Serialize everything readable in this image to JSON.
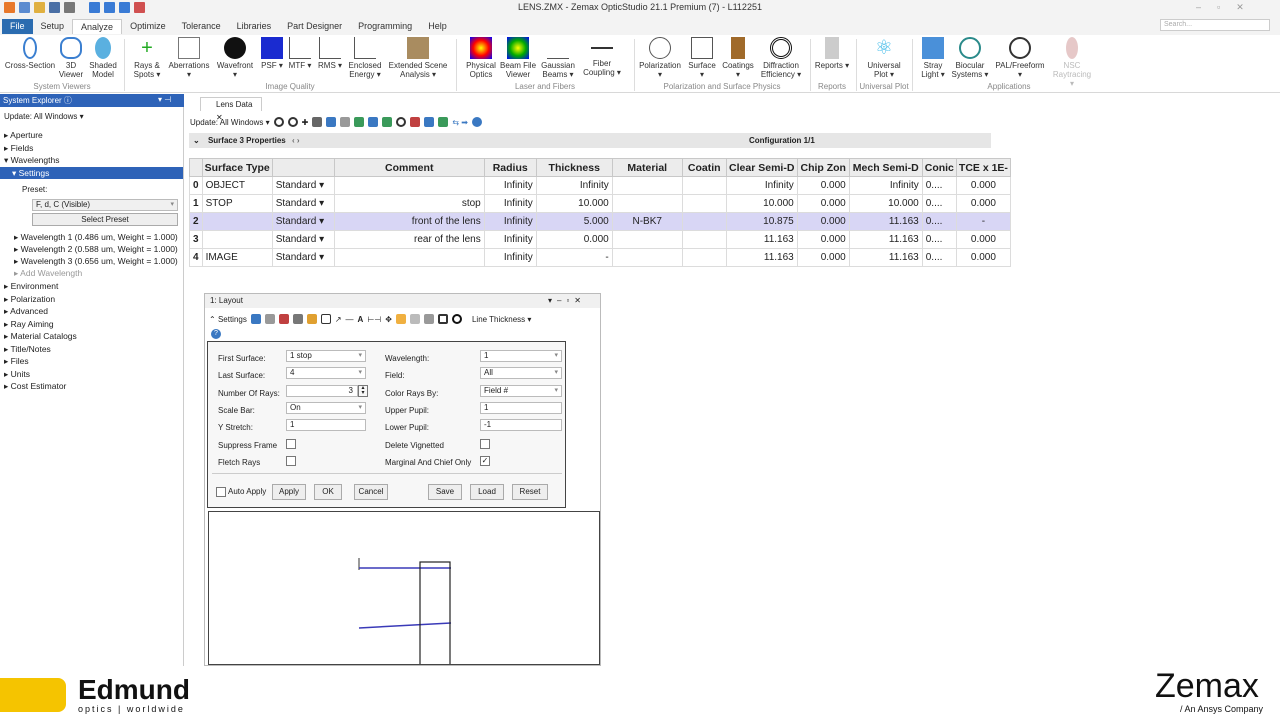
{
  "window": {
    "title": "LENS.ZMX - Zemax OpticStudio 21.1   Premium (7) - L112251",
    "search_placeholder": "Search..."
  },
  "menu_tabs": [
    "File",
    "Setup",
    "Analyze",
    "Optimize",
    "Tolerance",
    "Libraries",
    "Part Designer",
    "Programming",
    "Help"
  ],
  "ribbon": {
    "buttons": [
      "Cross-Section",
      "3D Viewer",
      "Shaded Model",
      "Rays & Spots ▾",
      "Aberrations ▾",
      "Wavefront ▾",
      "PSF ▾",
      "MTF ▾",
      "RMS ▾",
      "Enclosed Energy ▾",
      "Extended Scene Analysis ▾",
      "Physical Optics",
      "Beam File Viewer",
      "Gaussian Beams ▾",
      "Fiber Coupling ▾",
      "Polarization ▾",
      "Surface ▾",
      "Coatings ▾",
      "Diffraction Efficiency ▾",
      "Reports ▾",
      "Universal Plot ▾",
      "Stray Light ▾",
      "Biocular Systems ▾",
      "PAL/Freeform ▾",
      "NSC Raytracing ▾"
    ],
    "groups": [
      "System Viewers",
      "Image Quality",
      "Laser and Fibers",
      "Polarization and Surface Physics",
      "Reports",
      "Universal Plot",
      "Applications"
    ]
  },
  "sidebar": {
    "title": "System Explorer ⓘ",
    "update": "Update: All Windows ▾",
    "items": [
      "Aperture",
      "Fields",
      "Wavelengths",
      "Settings"
    ],
    "preset_label": "Preset:",
    "preset_value": "F, d, C (Visible)",
    "select_preset": "Select Preset",
    "wavelengths": [
      "Wavelength 1 (0.486 um, Weight = 1.000)",
      "Wavelength 2 (0.588 um, Weight = 1.000)",
      "Wavelength 3 (0.656 um, Weight = 1.000)",
      "Add Wavelength"
    ],
    "more_items": [
      "Environment",
      "Polarization",
      "Advanced",
      "Ray Aiming",
      "Material Catalogs",
      "Title/Notes",
      "Files",
      "Units",
      "Cost Estimator"
    ]
  },
  "lens_data": {
    "tab": "Lens Data",
    "update": "Update: All Windows ▾",
    "surface_bar": "Surface  3 Properties",
    "configuration": "Configuration 1/1",
    "headers": [
      "",
      "Surface Type",
      "",
      "Comment",
      "Radius",
      "Thickness",
      "Material",
      "Coatin",
      "Clear Semi-D",
      "Chip Zon",
      "Mech Semi-D",
      "Conic",
      "TCE x 1E-"
    ],
    "rows": [
      [
        "0",
        "OBJECT",
        "Standard ▾",
        "",
        "Infinity",
        "Infinity",
        "",
        "",
        "Infinity",
        "0.000",
        "Infinity",
        "0....",
        "0.000"
      ],
      [
        "1",
        "STOP",
        "Standard ▾",
        "stop",
        "Infinity",
        "10.000",
        "",
        "",
        "10.000",
        "0.000",
        "10.000",
        "0....",
        "0.000"
      ],
      [
        "2",
        "",
        "Standard ▾",
        "front of the lens",
        "Infinity",
        "5.000",
        "N-BK7",
        "",
        "10.875",
        "0.000",
        "11.163",
        "0....",
        "-"
      ],
      [
        "3",
        "",
        "Standard ▾",
        "rear of the lens",
        "Infinity",
        "0.000",
        "",
        "",
        "11.163",
        "0.000",
        "11.163",
        "0....",
        "0.000"
      ],
      [
        "4",
        "IMAGE",
        "Standard ▾",
        "",
        "Infinity",
        "-",
        "",
        "",
        "11.163",
        "0.000",
        "11.163",
        "0....",
        "0.000"
      ]
    ]
  },
  "layout": {
    "title": "1: Layout",
    "settings": "Settings",
    "line_thickness": "Line Thickness ▾",
    "left_fields": [
      [
        "First Surface:",
        "1 stop"
      ],
      [
        "Last Surface:",
        "4"
      ],
      [
        "Number Of Rays:",
        "3"
      ],
      [
        "Scale Bar:",
        "On"
      ],
      [
        "Y Stretch:",
        "1"
      ]
    ],
    "right_fields": [
      [
        "Wavelength:",
        "1"
      ],
      [
        "Field:",
        "All"
      ],
      [
        "Color Rays By:",
        "Field #"
      ],
      [
        "Upper Pupil:",
        "1"
      ],
      [
        "Lower Pupil:",
        "-1"
      ]
    ],
    "suppress_frame": "Suppress Frame",
    "fletch_rays": "Fletch Rays",
    "delete_vignetted": "Delete Vignetted",
    "marginal_chief": "Marginal And Chief Only",
    "auto_apply": "Auto Apply",
    "apply": "Apply",
    "ok": "OK",
    "cancel": "Cancel",
    "save": "Save",
    "load": "Load",
    "reset": "Reset"
  },
  "banner": {
    "edmund_1": "Edmund",
    "edmund_2": "optics | worldwide",
    "zemax": "Zemax",
    "zemax_sub": "/ An Ansys Company"
  },
  "colors": {
    "accent": "#2e63b8",
    "ray": "#3a3ab8",
    "edmund_yellow": "#f5c400"
  }
}
